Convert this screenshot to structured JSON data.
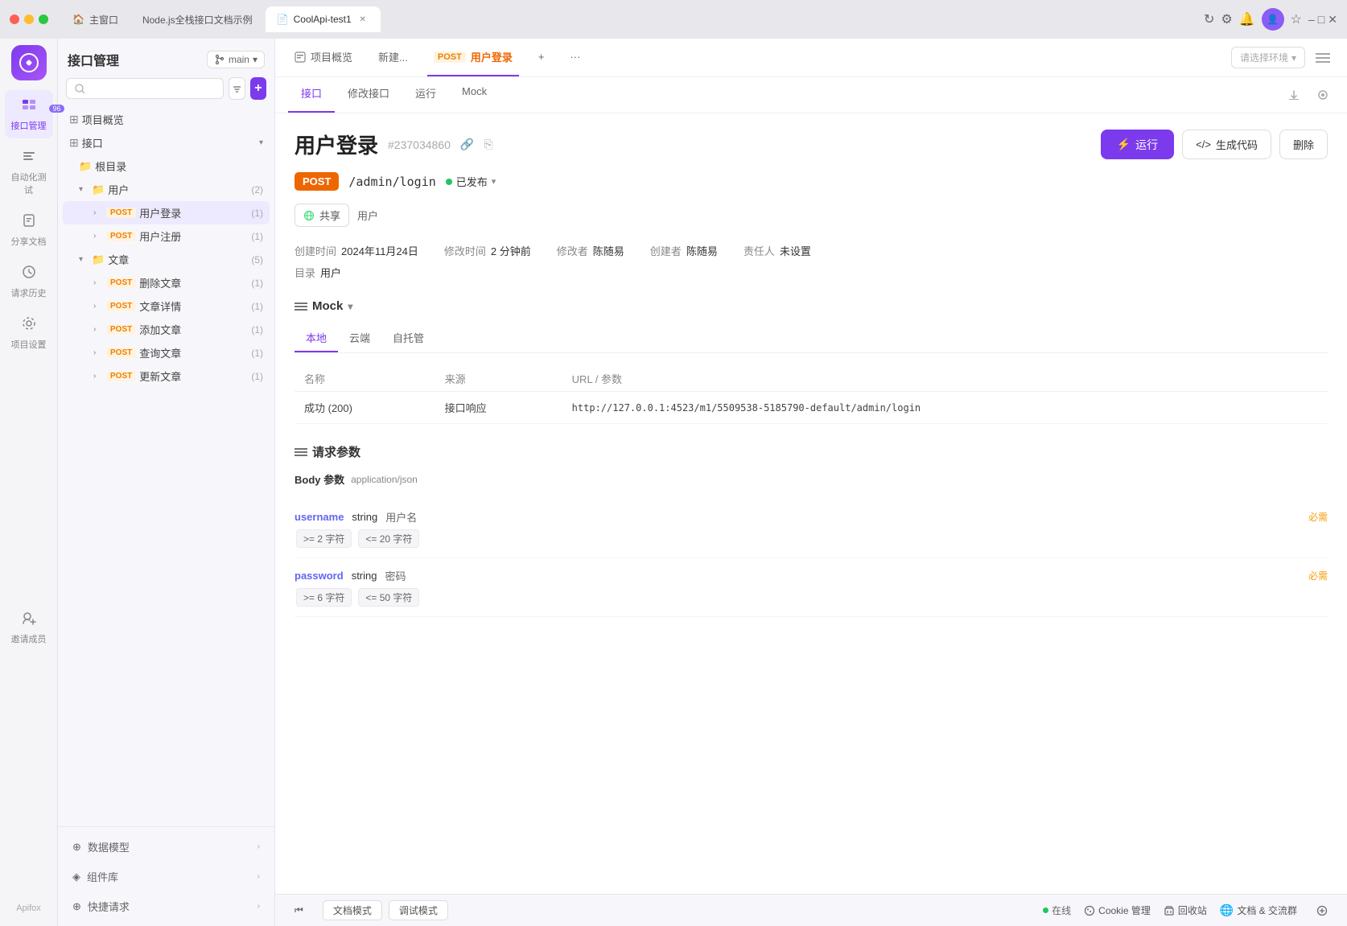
{
  "browser": {
    "tabs": [
      {
        "id": "home",
        "label": "主窗口",
        "active": false,
        "icon": "🏠"
      },
      {
        "id": "nodejs",
        "label": "Node.js全栈接口文档示例",
        "active": false,
        "icon": ""
      },
      {
        "id": "coolapi",
        "label": "CoolApi-test1",
        "active": true,
        "icon": "📄"
      }
    ],
    "window_controls": {
      "min": "–",
      "max": "□",
      "close": "✕"
    }
  },
  "icon_nav": {
    "items": [
      {
        "id": "interface",
        "icon": "🔌",
        "label": "接口管理",
        "active": true,
        "badge": "96"
      },
      {
        "id": "auto-test",
        "icon": "≡",
        "label": "自动化测试",
        "active": false
      },
      {
        "id": "share-doc",
        "icon": "📖",
        "label": "分享文档",
        "active": false
      },
      {
        "id": "history",
        "icon": "🕐",
        "label": "请求历史",
        "active": false
      },
      {
        "id": "settings",
        "icon": "⚙",
        "label": "项目设置",
        "active": false
      },
      {
        "id": "invite",
        "icon": "👤+",
        "label": "邀请成员",
        "active": false
      }
    ],
    "bottom_label": "Apifox"
  },
  "sidebar": {
    "title": "接口管理",
    "branch": "main",
    "branch_dropdown": "▾",
    "search_placeholder": "",
    "tree": {
      "overview": "项目概览",
      "interface_label": "接口",
      "root": "根目录",
      "user_folder": "用户",
      "user_count": "(2)",
      "user_children": [
        {
          "method": "POST",
          "label": "用户登录",
          "count": "(1)",
          "active": true
        },
        {
          "method": "POST",
          "label": "用户注册",
          "count": "(1)",
          "active": false
        }
      ],
      "article_folder": "文章",
      "article_count": "(5)",
      "article_children": [
        {
          "method": "POST",
          "label": "删除文章",
          "count": "(1)"
        },
        {
          "method": "POST",
          "label": "文章详情",
          "count": "(1)"
        },
        {
          "method": "POST",
          "label": "添加文章",
          "count": "(1)"
        },
        {
          "method": "POST",
          "label": "查询文章",
          "count": "(1)"
        },
        {
          "method": "POST",
          "label": "更新文章",
          "count": "(1)"
        }
      ]
    },
    "footer_items": [
      {
        "icon": "⊕",
        "label": "数据模型"
      },
      {
        "icon": "◈",
        "label": "组件库"
      },
      {
        "icon": "⊕",
        "label": "快捷请求"
      }
    ]
  },
  "main": {
    "tabs_bar": {
      "overview": "项目概览",
      "new": "新建...",
      "post_badge": "POST",
      "post_title": "用户登录",
      "add_icon": "+",
      "more_icon": "···"
    },
    "env_select": {
      "placeholder": "请选择环境",
      "dropdown": "▾"
    },
    "sub_tabs": [
      {
        "label": "接口",
        "active": true
      },
      {
        "label": "修改接口",
        "active": false
      },
      {
        "label": "运行",
        "active": false
      },
      {
        "label": "Mock",
        "active": false
      }
    ],
    "interface": {
      "title": "用户登录",
      "id": "#237034860",
      "link_icon": "🔗",
      "copy_icon": "⎘",
      "method": "POST",
      "path": "/admin/login",
      "status": "已发布",
      "status_dropdown": "▾",
      "run_button": "运行",
      "generate_code_button": "生成代码",
      "delete_button": "删除",
      "share_button": "共享",
      "share_user": "用户",
      "meta": {
        "created_label": "创建时间",
        "created_value": "2024年11月24日",
        "modified_label": "修改时间",
        "modified_value": "2 分钟前",
        "modifier_label": "修改者",
        "modifier_value": "陈随易",
        "creator_label": "创建者",
        "creator_value": "陈随易",
        "owner_label": "责任人",
        "owner_value": "未设置"
      },
      "directory_label": "目录",
      "directory_value": "用户"
    },
    "mock": {
      "section_title": "Mock",
      "dropdown": "▾",
      "tabs": [
        {
          "label": "本地",
          "active": true
        },
        {
          "label": "云端",
          "active": false
        },
        {
          "label": "自托管",
          "active": false
        }
      ],
      "table": {
        "headers": [
          "名称",
          "来源",
          "URL / 参数"
        ],
        "rows": [
          {
            "name": "成功 (200)",
            "source": "接口响应",
            "url": "http://127.0.0.1:4523/m1/5509538-5185790-default/admin/login"
          }
        ]
      }
    },
    "request_params": {
      "section_title": "请求参数",
      "body_label": "Body 参数",
      "content_type": "application/json",
      "params": [
        {
          "name": "username",
          "type": "string",
          "description": "用户名",
          "required": "必需",
          "constraints": [
            ">= 2 字符",
            "<= 20 字符"
          ]
        },
        {
          "name": "password",
          "type": "string",
          "description": "密码",
          "required": "必需",
          "constraints": [
            ">= 6 字符",
            "<= 50 字符"
          ]
        }
      ]
    },
    "footer": {
      "back_icon": "⏮",
      "doc_mode": "文档模式",
      "debug_mode": "调试模式",
      "online_label": "在线",
      "cookie_label": "Cookie 管理",
      "recycle_label": "回收站",
      "community_label": "文档 & 交流群",
      "more_icon": "⊕"
    }
  }
}
